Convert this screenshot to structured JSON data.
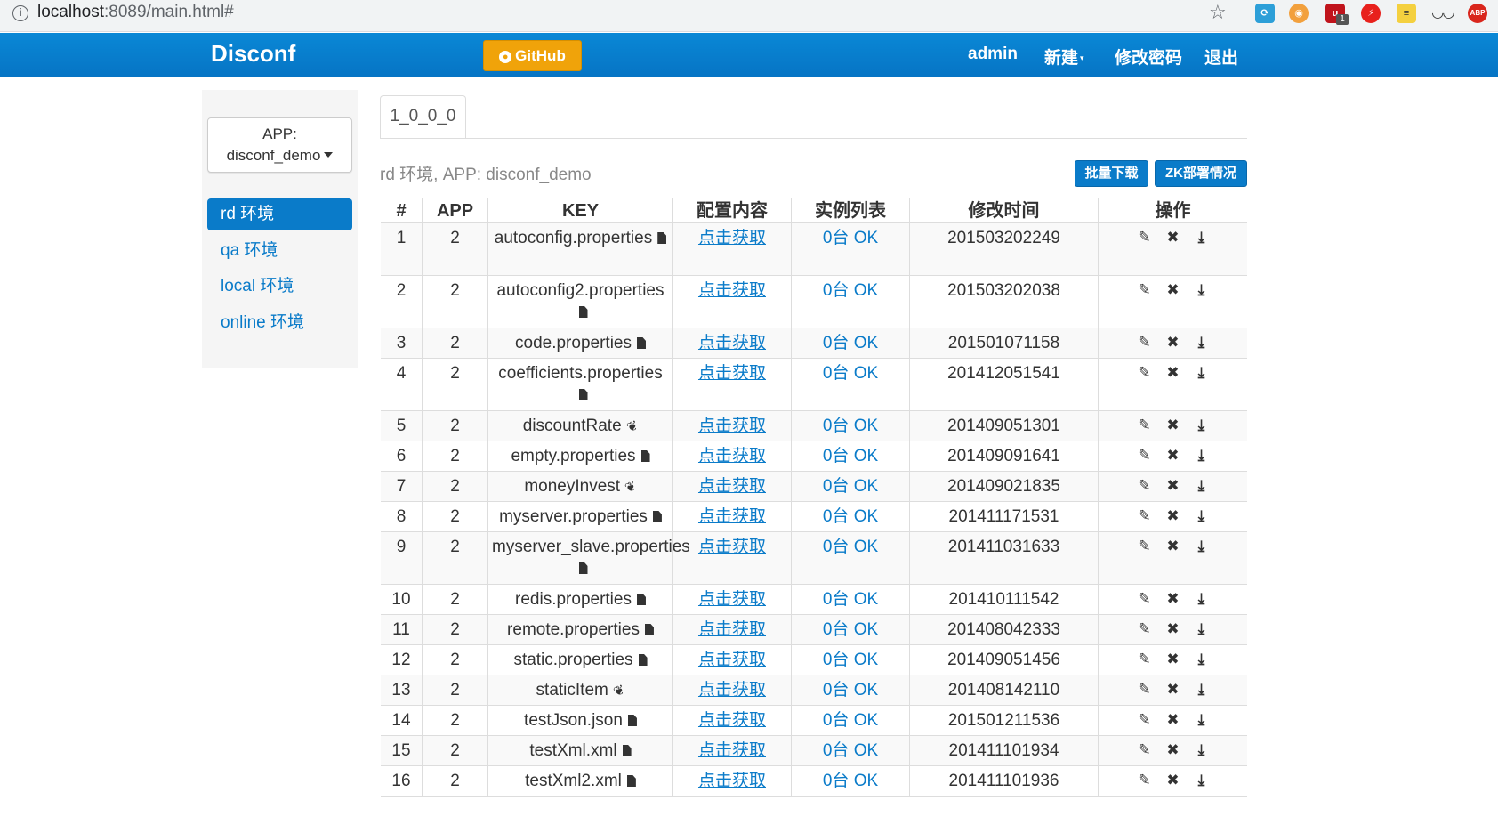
{
  "browser": {
    "url_host": "localhost",
    "url_path": ":8089/main.html#",
    "ext_badge": "1"
  },
  "navbar": {
    "brand": "Disconf",
    "github": "GitHub",
    "user": "admin",
    "create": "新建",
    "change_password": "修改密码",
    "logout": "退出"
  },
  "sidebar": {
    "app_label": "APP:",
    "app_value": "disconf_demo",
    "envs": [
      "rd 环境",
      "qa 环境",
      "local 环境",
      "online 环境"
    ]
  },
  "main": {
    "tab": "1_0_0_0",
    "context": "rd 环境, APP: disconf_demo",
    "batch_download": "批量下载",
    "zk_status": "ZK部署情况"
  },
  "table": {
    "headers": [
      "#",
      "APP",
      "KEY",
      "配置内容",
      "实例列表",
      "修改时间",
      "操作"
    ],
    "rows": [
      {
        "id": "1",
        "app": "2",
        "key": "autoconfig.properties",
        "type": "file",
        "content": "点击获取",
        "instances": "0台 OK",
        "time": "201503202249"
      },
      {
        "id": "2",
        "app": "2",
        "key": "autoconfig2.properties",
        "type": "file",
        "content": "点击获取",
        "instances": "0台 OK",
        "time": "201503202038"
      },
      {
        "id": "3",
        "app": "2",
        "key": "code.properties",
        "type": "file",
        "content": "点击获取",
        "instances": "0台 OK",
        "time": "201501071158"
      },
      {
        "id": "4",
        "app": "2",
        "key": "coefficients.properties",
        "type": "file",
        "content": "点击获取",
        "instances": "0台 OK",
        "time": "201412051541"
      },
      {
        "id": "5",
        "app": "2",
        "key": "discountRate",
        "type": "item",
        "content": "点击获取",
        "instances": "0台 OK",
        "time": "201409051301"
      },
      {
        "id": "6",
        "app": "2",
        "key": "empty.properties",
        "type": "file",
        "content": "点击获取",
        "instances": "0台 OK",
        "time": "201409091641"
      },
      {
        "id": "7",
        "app": "2",
        "key": "moneyInvest",
        "type": "item",
        "content": "点击获取",
        "instances": "0台 OK",
        "time": "201409021835"
      },
      {
        "id": "8",
        "app": "2",
        "key": "myserver.properties",
        "type": "file",
        "content": "点击获取",
        "instances": "0台 OK",
        "time": "201411171531"
      },
      {
        "id": "9",
        "app": "2",
        "key": "myserver_slave.properties",
        "type": "file",
        "content": "点击获取",
        "instances": "0台 OK",
        "time": "201411031633"
      },
      {
        "id": "10",
        "app": "2",
        "key": "redis.properties",
        "type": "file",
        "content": "点击获取",
        "instances": "0台 OK",
        "time": "201410111542"
      },
      {
        "id": "11",
        "app": "2",
        "key": "remote.properties",
        "type": "file",
        "content": "点击获取",
        "instances": "0台 OK",
        "time": "201408042333"
      },
      {
        "id": "12",
        "app": "2",
        "key": "static.properties",
        "type": "file",
        "content": "点击获取",
        "instances": "0台 OK",
        "time": "201409051456"
      },
      {
        "id": "13",
        "app": "2",
        "key": "staticItem",
        "type": "item",
        "content": "点击获取",
        "instances": "0台 OK",
        "time": "201408142110"
      },
      {
        "id": "14",
        "app": "2",
        "key": "testJson.json",
        "type": "file",
        "content": "点击获取",
        "instances": "0台 OK",
        "time": "201501211536"
      },
      {
        "id": "15",
        "app": "2",
        "key": "testXml.xml",
        "type": "file",
        "content": "点击获取",
        "instances": "0台 OK",
        "time": "201411101934"
      },
      {
        "id": "16",
        "app": "2",
        "key": "testXml2.xml",
        "type": "file",
        "content": "点击获取",
        "instances": "0台 OK",
        "time": "201411101936"
      }
    ]
  }
}
